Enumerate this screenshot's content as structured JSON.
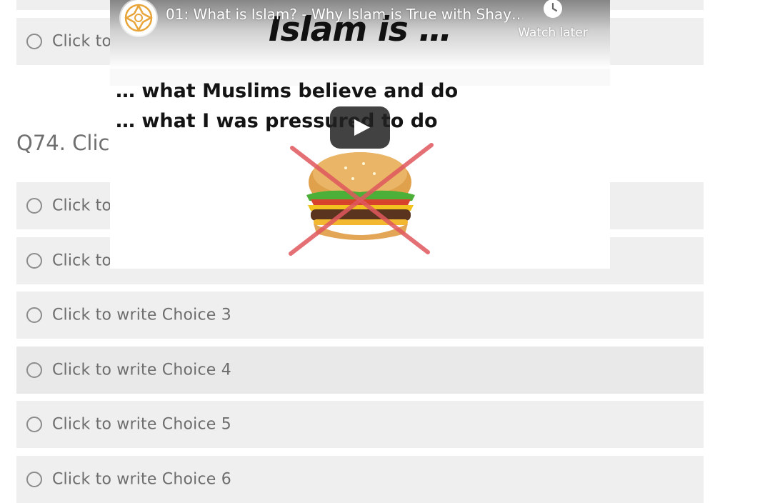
{
  "question": {
    "title": "Q74. Clic"
  },
  "choices_above": [
    {
      "label": "Click to"
    }
  ],
  "choices": [
    {
      "label": "Click to"
    },
    {
      "label": "Click to"
    },
    {
      "label": "Click to write Choice 3"
    },
    {
      "label": "Click to write Choice 4"
    },
    {
      "label": "Click to write Choice 5"
    },
    {
      "label": "Click to write Choice 6"
    }
  ],
  "video": {
    "title": "01: What is Islam? - Why Islam is True with Shay…",
    "watch_later": "Watch later",
    "slide": {
      "heading": "Islam is …",
      "line1": "… what Muslims believe and do",
      "line2": "… what I was pressured to do"
    },
    "icons": {
      "channel": "channel-logo-icon",
      "watch_later": "clock-icon",
      "play": "play-icon"
    },
    "colors": {
      "play_bg": "#212121",
      "cross": "#e0585e",
      "logo": "#e8a53a"
    }
  }
}
